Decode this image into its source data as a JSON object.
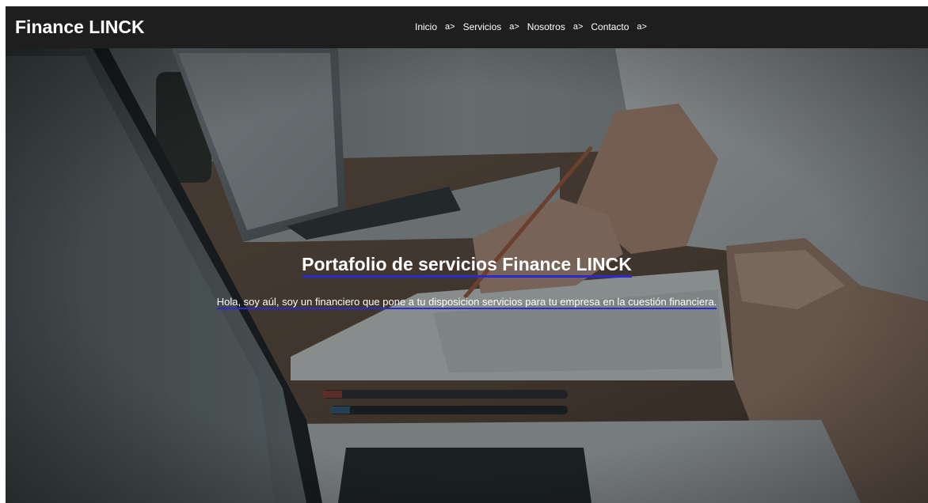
{
  "header": {
    "brand": "Finance LINCK",
    "nav": [
      {
        "label": "Inicio",
        "suffix": "a>"
      },
      {
        "label": "Servicios",
        "suffix": "a>"
      },
      {
        "label": "Nosotros",
        "suffix": "a>"
      },
      {
        "label": "Contacto",
        "suffix": "a>"
      }
    ]
  },
  "hero": {
    "title": "Portafolio de servicios Finance LINCK",
    "text": "Hola, soy aúl, soy un financiero que pone a tu disposicion servicios para tu empresa en la cuestión financiera."
  },
  "colors": {
    "topbar": "#1e1e1e",
    "underline": "#2a2ad0",
    "text": "#ffffff"
  }
}
